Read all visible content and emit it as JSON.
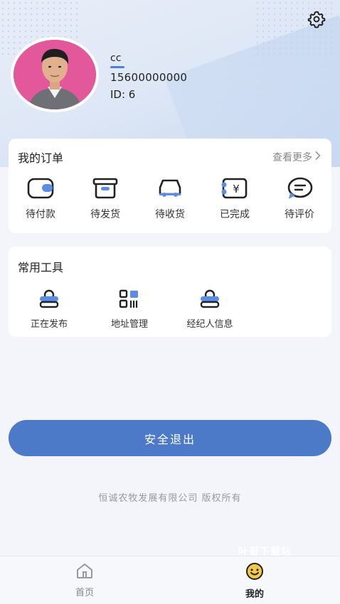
{
  "profile": {
    "name": "cc",
    "phone": "15600000000",
    "id_text": "ID: 6"
  },
  "orders": {
    "title": "我的订单",
    "view_more": "查看更多",
    "items": [
      {
        "label": "待付款",
        "icon": "wallet-icon"
      },
      {
        "label": "待发货",
        "icon": "box-icon"
      },
      {
        "label": "待收货",
        "icon": "truck-icon"
      },
      {
        "label": "已完成",
        "icon": "receipt-icon"
      },
      {
        "label": "待评价",
        "icon": "chat-icon"
      }
    ]
  },
  "tools": {
    "title": "常用工具",
    "items": [
      {
        "label": "正在发布",
        "icon": "publish-icon"
      },
      {
        "label": "地址管理",
        "icon": "address-icon"
      },
      {
        "label": "经纪人信息",
        "icon": "agent-icon"
      }
    ]
  },
  "logout_label": "安全退出",
  "copyright": "恒诚农牧发展有限公司 版权所有",
  "tabbar": {
    "home_label": "首页",
    "mine_label": "我的"
  },
  "watermark": "叶哥下载站",
  "colors": {
    "accent": "#4d79c9",
    "icon_blue": "#5b8de6",
    "avatar_bg": "#e2589a"
  }
}
